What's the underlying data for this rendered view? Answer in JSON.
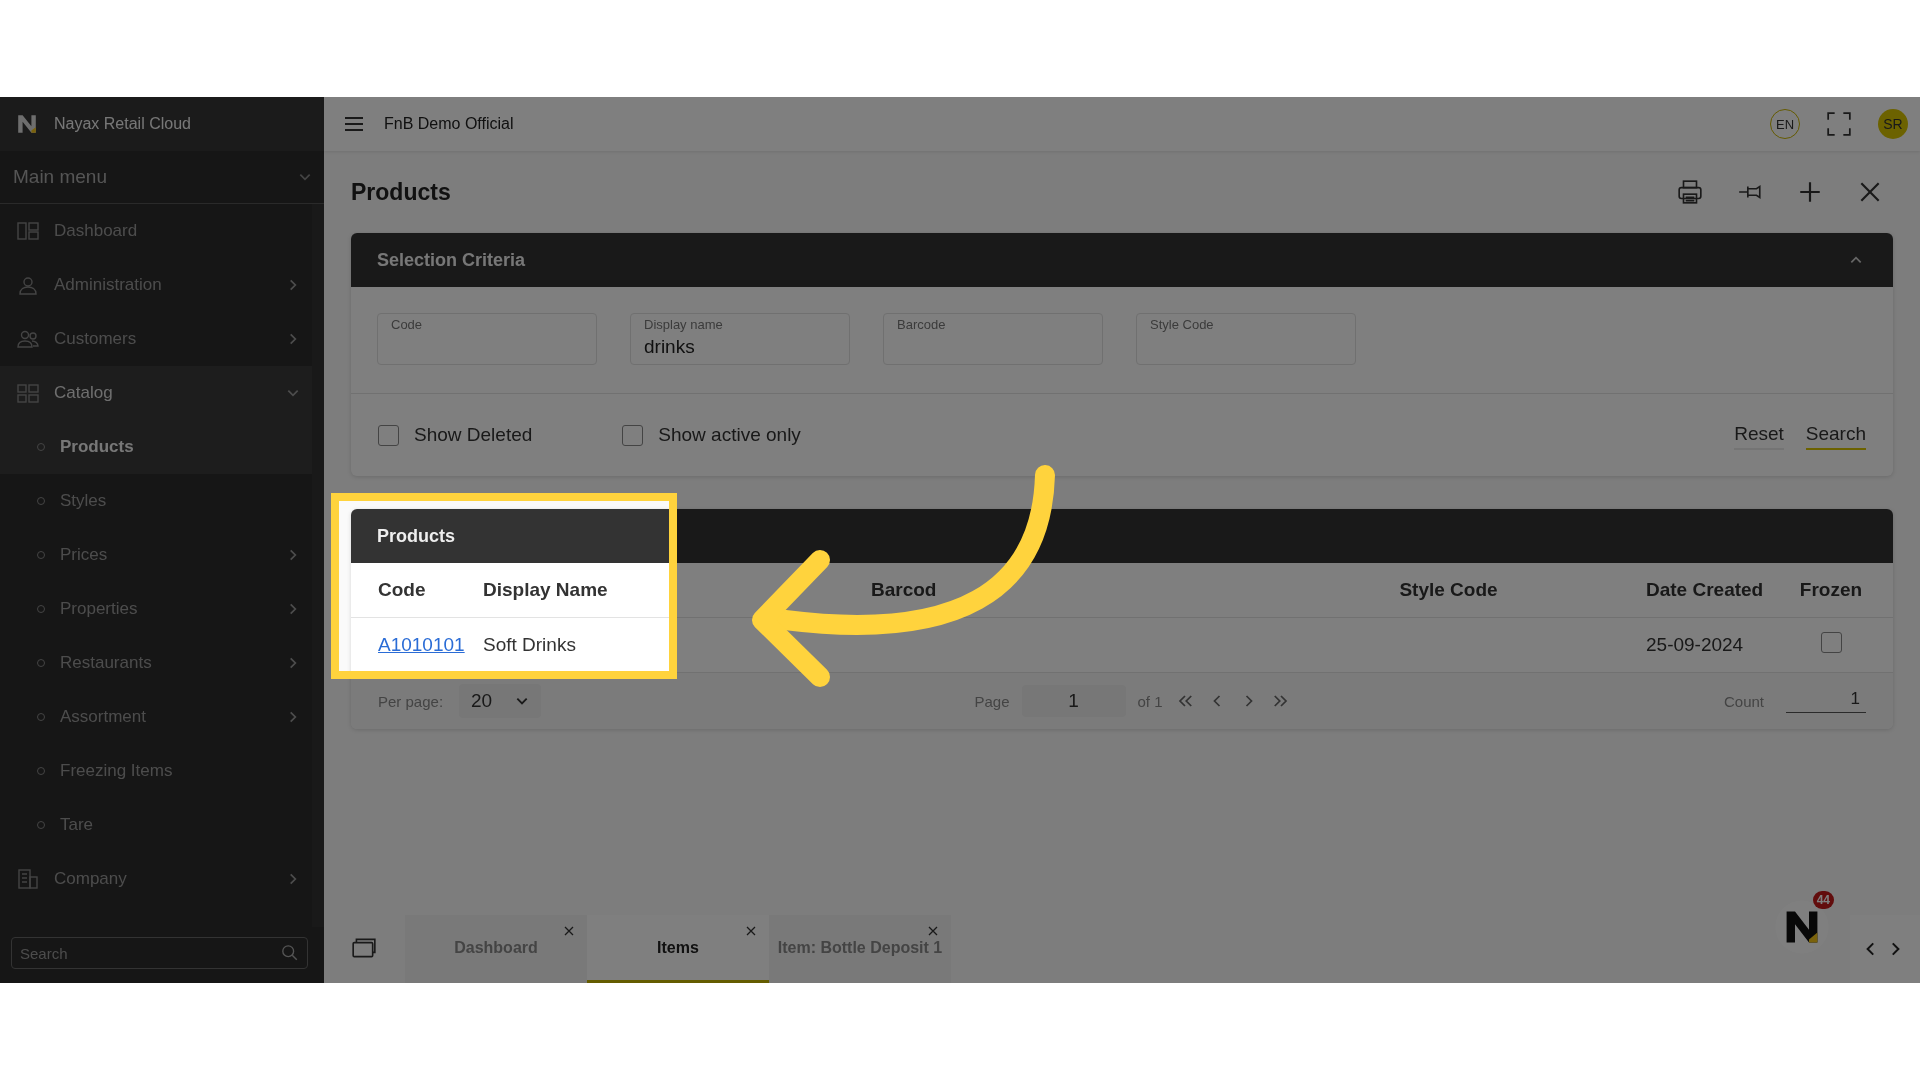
{
  "brand": {
    "name": "Nayax Retail Cloud"
  },
  "sidebar": {
    "menu_title": "Main menu",
    "items": [
      {
        "label": "Dashboard",
        "selected": false
      },
      {
        "label": "Administration",
        "expanded": false,
        "selected": false
      },
      {
        "label": "Customers",
        "expanded": false,
        "selected": false
      },
      {
        "label": "Catalog",
        "expanded": true,
        "selected": false,
        "children": [
          {
            "label": "Products",
            "selected": true
          },
          {
            "label": "Styles",
            "selected": false
          },
          {
            "label": "Prices",
            "expanded": false,
            "selected": false
          },
          {
            "label": "Properties",
            "expanded": false,
            "selected": false
          },
          {
            "label": "Restaurants",
            "expanded": false,
            "selected": false
          },
          {
            "label": "Assortment",
            "expanded": false,
            "selected": false
          },
          {
            "label": "Freezing Items",
            "selected": false
          },
          {
            "label": "Tare",
            "selected": false
          }
        ]
      },
      {
        "label": "Company",
        "expanded": false,
        "selected": false
      }
    ],
    "search": {
      "placeholder": "Search"
    }
  },
  "topbar": {
    "title": "FnB Demo Official",
    "language": "EN",
    "avatar": "SR"
  },
  "page": {
    "title": "Products"
  },
  "criteria": {
    "title": "Selection Criteria",
    "fields": [
      {
        "label": "Code"
      },
      {
        "label": "Display name",
        "value": "drinks"
      },
      {
        "label": "Barcode"
      },
      {
        "label": "Style Code"
      }
    ],
    "checkboxes": [
      {
        "label": "Show Deleted",
        "checked": false
      },
      {
        "label": "Show active only",
        "checked": false
      }
    ],
    "buttons": [
      "Reset",
      "Search"
    ]
  },
  "table": {
    "title": "Products",
    "columns": [
      "Code",
      "Display Name",
      "Barcod",
      "Style Code",
      "Date Created",
      "Frozen"
    ],
    "rows": [
      {
        "code": "A1010101",
        "display_name": "Soft Drinks",
        "date_created": "25-09-2024",
        "frozen": false
      }
    ],
    "per_page_label": "Per page:",
    "per_page": "20",
    "page_label": "Page",
    "page": "1",
    "page_of": "of 1",
    "count_label": "Count",
    "count": "1"
  },
  "tabs": [
    {
      "label": "Dashboard",
      "selected": false
    },
    {
      "label": "Items",
      "selected": true
    },
    {
      "label": "Item: Bottle Deposit 1",
      "selected": false
    }
  ],
  "notification": {
    "count": "44"
  }
}
